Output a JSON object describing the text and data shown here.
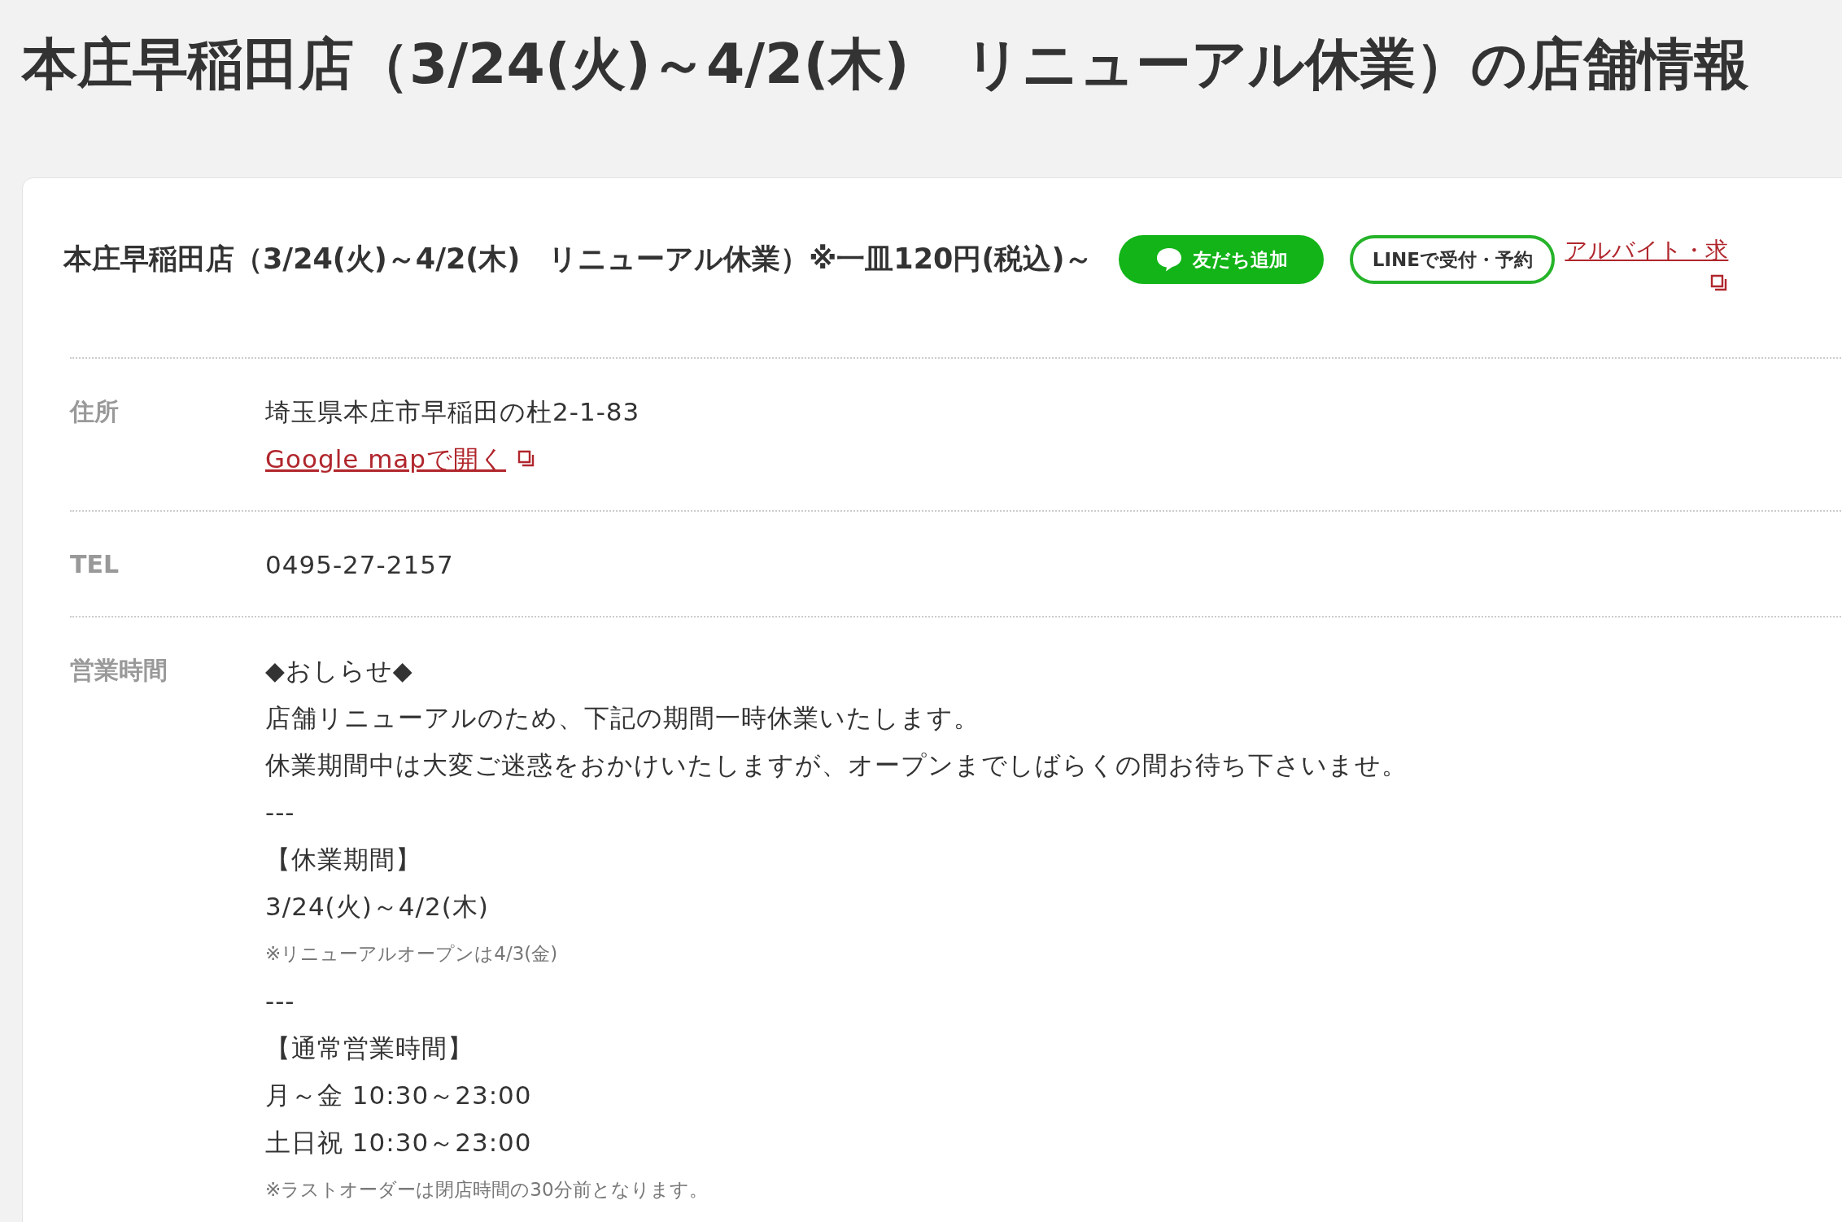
{
  "page_title": "本庄早稲田店（3/24(火)～4/2(木)　リニューアル休業）の店舗情報",
  "card": {
    "title": "本庄早稲田店（3/24(火)～4/2(木)　リニューアル休業）※一皿120円(税込)～",
    "buttons": [
      {
        "kind": "line-friend",
        "label": "友だち追加"
      },
      {
        "kind": "line-reserve",
        "label": "LINEで受付・予約"
      }
    ],
    "side_link": "アルバイト・求",
    "rows": [
      {
        "label": "住所",
        "lines": [
          {
            "kind": "text",
            "text": "埼玉県本庄市早稲田の杜2-1-83"
          },
          {
            "kind": "link",
            "text": "Google mapで開く"
          }
        ]
      },
      {
        "label": "TEL",
        "lines": [
          {
            "kind": "text",
            "text": "0495-27-2157"
          }
        ]
      },
      {
        "label": "営業時間",
        "lines": [
          {
            "kind": "text",
            "text": "◆おしらせ◆"
          },
          {
            "kind": "text",
            "text": "店舗リニューアルのため、下記の期間一時休業いたします。"
          },
          {
            "kind": "text",
            "text": "休業期間中は大変ご迷惑をおかけいたしますが、オープンまでしばらくの間お待ち下さいませ。"
          },
          {
            "kind": "text",
            "text": "---"
          },
          {
            "kind": "text",
            "text": "【休業期間】"
          },
          {
            "kind": "text",
            "text": "3/24(火)～4/2(木)"
          },
          {
            "kind": "note",
            "text": "※リニューアルオープンは4/3(金)"
          },
          {
            "kind": "text",
            "text": "---"
          },
          {
            "kind": "text",
            "text": "【通常営業時間】"
          },
          {
            "kind": "text",
            "text": "月～金 10:30～23:00"
          },
          {
            "kind": "text",
            "text": "土日祝 10:30～23:00"
          },
          {
            "kind": "note",
            "text": "※ラストオーダーは閉店時間の30分前となります。"
          }
        ]
      }
    ]
  }
}
